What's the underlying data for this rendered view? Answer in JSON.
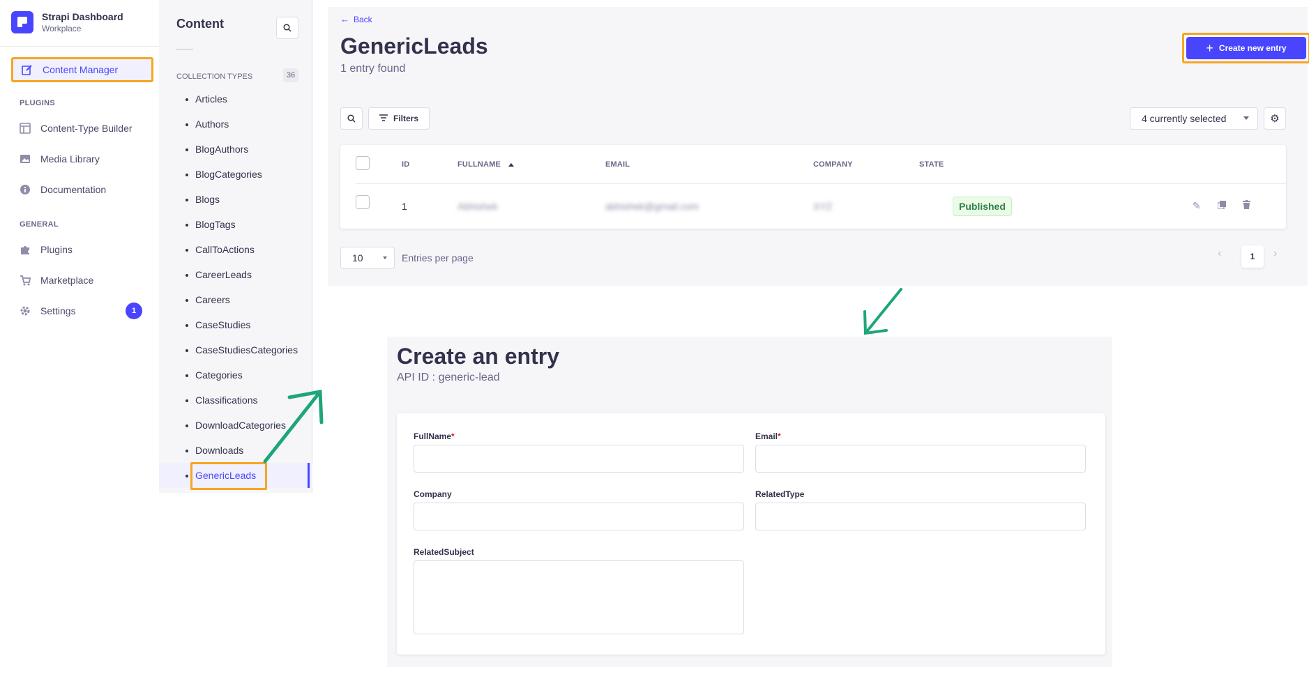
{
  "brand": {
    "title": "Strapi Dashboard",
    "subtitle": "Workplace"
  },
  "mainnav": {
    "content_manager": "Content Manager",
    "plugins_section": "PLUGINS",
    "plugins_items": [
      {
        "label": "Content-Type Builder",
        "icon": "layout-icon"
      },
      {
        "label": "Media Library",
        "icon": "image-icon"
      },
      {
        "label": "Documentation",
        "icon": "info-icon"
      }
    ],
    "general_section": "GENERAL",
    "general_items": [
      {
        "label": "Plugins",
        "icon": "puzzle-icon"
      },
      {
        "label": "Marketplace",
        "icon": "cart-icon"
      },
      {
        "label": "Settings",
        "icon": "gear-icon",
        "badge": "1"
      }
    ]
  },
  "subnav": {
    "title": "Content",
    "collection_types_label": "COLLECTION TYPES",
    "collection_types_count": "36",
    "items": [
      "Articles",
      "Authors",
      "BlogAuthors",
      "BlogCategories",
      "Blogs",
      "BlogTags",
      "CallToActions",
      "CareerLeads",
      "Careers",
      "CaseStudies",
      "CaseStudiesCategories",
      "Categories",
      "Classifications",
      "DownloadCategories",
      "Downloads",
      "GenericLeads"
    ],
    "active_item": "GenericLeads"
  },
  "listview": {
    "back_label": "Back",
    "title": "GenericLeads",
    "subtitle": "1 entry found",
    "create_button": "Create new entry",
    "filters_label": "Filters",
    "columns_select": "4 currently selected",
    "headers": {
      "id": "ID",
      "fullname": "FULLNAME",
      "email": "EMAIL",
      "company": "COMPANY",
      "state": "STATE"
    },
    "rows": [
      {
        "id": "1",
        "fullname": "Abhishek",
        "email": "abhishek@gmail.com",
        "company": "XYZ",
        "state": "Published"
      }
    ],
    "per_page_value": "10",
    "per_page_label": "Entries per page",
    "current_page": "1"
  },
  "createview": {
    "title": "Create an entry",
    "api_id": "API ID : generic-lead",
    "fields": {
      "fullname": "FullName",
      "email": "Email",
      "company": "Company",
      "related_type": "RelatedType",
      "related_subject": "RelatedSubject",
      "required_mark": "*"
    }
  },
  "colors": {
    "accent": "#4945ff",
    "highlight": "#f5a623",
    "arrow": "#1fa57a",
    "published": "#328048"
  }
}
